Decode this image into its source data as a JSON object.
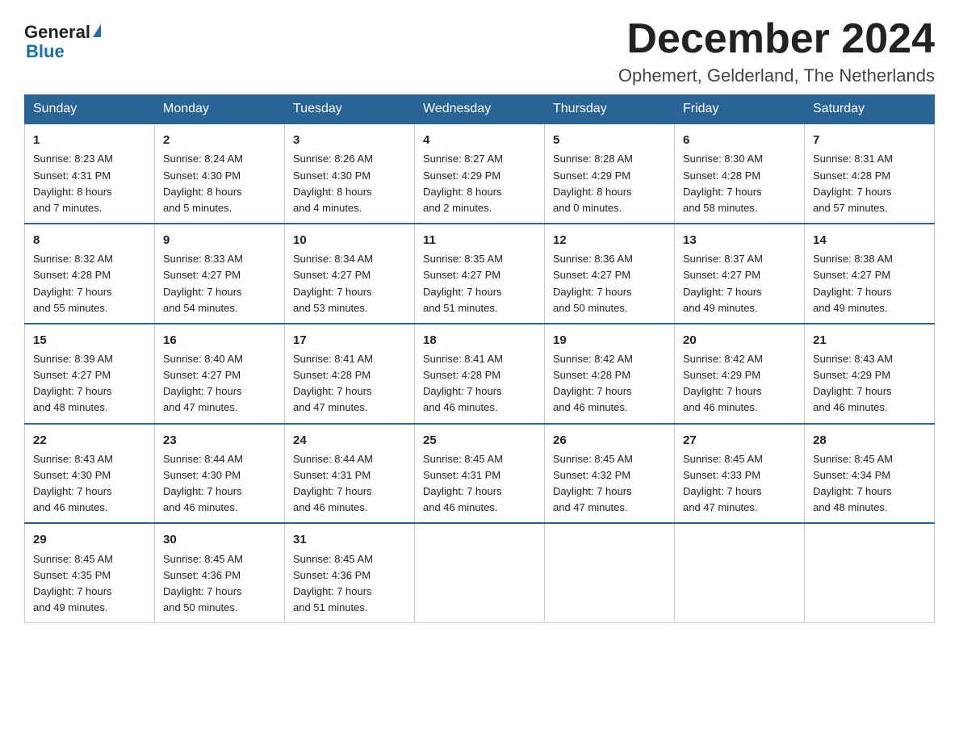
{
  "logo": {
    "text_general": "General",
    "triangle": "▶",
    "text_blue": "Blue"
  },
  "header": {
    "month_title": "December 2024",
    "location": "Ophemert, Gelderland, The Netherlands"
  },
  "weekdays": [
    "Sunday",
    "Monday",
    "Tuesday",
    "Wednesday",
    "Thursday",
    "Friday",
    "Saturday"
  ],
  "weeks": [
    [
      {
        "day": "1",
        "sunrise": "8:23 AM",
        "sunset": "4:31 PM",
        "daylight": "8 hours and 7 minutes."
      },
      {
        "day": "2",
        "sunrise": "8:24 AM",
        "sunset": "4:30 PM",
        "daylight": "8 hours and 5 minutes."
      },
      {
        "day": "3",
        "sunrise": "8:26 AM",
        "sunset": "4:30 PM",
        "daylight": "8 hours and 4 minutes."
      },
      {
        "day": "4",
        "sunrise": "8:27 AM",
        "sunset": "4:29 PM",
        "daylight": "8 hours and 2 minutes."
      },
      {
        "day": "5",
        "sunrise": "8:28 AM",
        "sunset": "4:29 PM",
        "daylight": "8 hours and 0 minutes."
      },
      {
        "day": "6",
        "sunrise": "8:30 AM",
        "sunset": "4:28 PM",
        "daylight": "7 hours and 58 minutes."
      },
      {
        "day": "7",
        "sunrise": "8:31 AM",
        "sunset": "4:28 PM",
        "daylight": "7 hours and 57 minutes."
      }
    ],
    [
      {
        "day": "8",
        "sunrise": "8:32 AM",
        "sunset": "4:28 PM",
        "daylight": "7 hours and 55 minutes."
      },
      {
        "day": "9",
        "sunrise": "8:33 AM",
        "sunset": "4:27 PM",
        "daylight": "7 hours and 54 minutes."
      },
      {
        "day": "10",
        "sunrise": "8:34 AM",
        "sunset": "4:27 PM",
        "daylight": "7 hours and 53 minutes."
      },
      {
        "day": "11",
        "sunrise": "8:35 AM",
        "sunset": "4:27 PM",
        "daylight": "7 hours and 51 minutes."
      },
      {
        "day": "12",
        "sunrise": "8:36 AM",
        "sunset": "4:27 PM",
        "daylight": "7 hours and 50 minutes."
      },
      {
        "day": "13",
        "sunrise": "8:37 AM",
        "sunset": "4:27 PM",
        "daylight": "7 hours and 49 minutes."
      },
      {
        "day": "14",
        "sunrise": "8:38 AM",
        "sunset": "4:27 PM",
        "daylight": "7 hours and 49 minutes."
      }
    ],
    [
      {
        "day": "15",
        "sunrise": "8:39 AM",
        "sunset": "4:27 PM",
        "daylight": "7 hours and 48 minutes."
      },
      {
        "day": "16",
        "sunrise": "8:40 AM",
        "sunset": "4:27 PM",
        "daylight": "7 hours and 47 minutes."
      },
      {
        "day": "17",
        "sunrise": "8:41 AM",
        "sunset": "4:28 PM",
        "daylight": "7 hours and 47 minutes."
      },
      {
        "day": "18",
        "sunrise": "8:41 AM",
        "sunset": "4:28 PM",
        "daylight": "7 hours and 46 minutes."
      },
      {
        "day": "19",
        "sunrise": "8:42 AM",
        "sunset": "4:28 PM",
        "daylight": "7 hours and 46 minutes."
      },
      {
        "day": "20",
        "sunrise": "8:42 AM",
        "sunset": "4:29 PM",
        "daylight": "7 hours and 46 minutes."
      },
      {
        "day": "21",
        "sunrise": "8:43 AM",
        "sunset": "4:29 PM",
        "daylight": "7 hours and 46 minutes."
      }
    ],
    [
      {
        "day": "22",
        "sunrise": "8:43 AM",
        "sunset": "4:30 PM",
        "daylight": "7 hours and 46 minutes."
      },
      {
        "day": "23",
        "sunrise": "8:44 AM",
        "sunset": "4:30 PM",
        "daylight": "7 hours and 46 minutes."
      },
      {
        "day": "24",
        "sunrise": "8:44 AM",
        "sunset": "4:31 PM",
        "daylight": "7 hours and 46 minutes."
      },
      {
        "day": "25",
        "sunrise": "8:45 AM",
        "sunset": "4:31 PM",
        "daylight": "7 hours and 46 minutes."
      },
      {
        "day": "26",
        "sunrise": "8:45 AM",
        "sunset": "4:32 PM",
        "daylight": "7 hours and 47 minutes."
      },
      {
        "day": "27",
        "sunrise": "8:45 AM",
        "sunset": "4:33 PM",
        "daylight": "7 hours and 47 minutes."
      },
      {
        "day": "28",
        "sunrise": "8:45 AM",
        "sunset": "4:34 PM",
        "daylight": "7 hours and 48 minutes."
      }
    ],
    [
      {
        "day": "29",
        "sunrise": "8:45 AM",
        "sunset": "4:35 PM",
        "daylight": "7 hours and 49 minutes."
      },
      {
        "day": "30",
        "sunrise": "8:45 AM",
        "sunset": "4:36 PM",
        "daylight": "7 hours and 50 minutes."
      },
      {
        "day": "31",
        "sunrise": "8:45 AM",
        "sunset": "4:36 PM",
        "daylight": "7 hours and 51 minutes."
      },
      null,
      null,
      null,
      null
    ]
  ]
}
